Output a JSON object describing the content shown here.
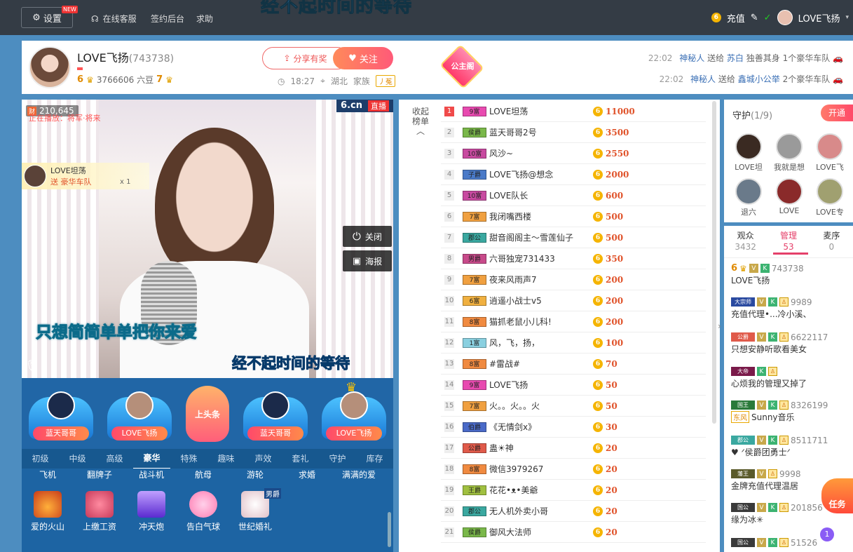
{
  "topbar": {
    "settings_label": "设置",
    "new_badge": "NEW",
    "nav": [
      "在线客服",
      "签约后台",
      "求助"
    ],
    "banner_text": "经不起时间的等待",
    "recharge_label": "充值",
    "user_name": "LOVE飞扬"
  },
  "anchor": {
    "name": "LOVE飞扬",
    "id": "(743738)",
    "level_rich": "6",
    "beans": "3766606 六豆",
    "level_star": "7",
    "share_label": "分享有奖",
    "follow_label": "关注",
    "time": "18:27",
    "location": "湖北",
    "family_label": "家族",
    "family_tag": "丿菟",
    "princess_label": "公主阁"
  },
  "broadcast": [
    {
      "time": "22:02",
      "from": "神秘人",
      "verb": "送给",
      "to": "苏白",
      "text": "独善其身 1个豪华车队"
    },
    {
      "time": "22:02",
      "from": "神秘人",
      "verb": "送给",
      "to": "鑫城小公举",
      "text": "2个豪华车队"
    }
  ],
  "video": {
    "fortune_icon": "财",
    "fortune_value": "210,645",
    "scroll_text": "正在播放：将军·将来",
    "logo": "6.cn",
    "live_tag": "直播",
    "gift_notice": {
      "name": "LOVE坦荡",
      "prefix": "送",
      "gift": "豪华车队",
      "count": "x 1"
    },
    "close_label": "关闭",
    "poster_label": "海报",
    "lyric_main": "只想简简单单把你来爱",
    "lyric_sub": "经不起时间的等待"
  },
  "seats": [
    {
      "name": "蓝天哥哥",
      "color": "#1b2a4a"
    },
    {
      "name": "LOVE飞扬",
      "color": "#b58f7a"
    },
    {
      "name": "上头条",
      "headline": true
    },
    {
      "name": "蓝天哥哥",
      "color": "#1b2a4a"
    },
    {
      "name": "LOVE飞扬",
      "color": "#b58f7a"
    }
  ],
  "gift_tabs": [
    "初级",
    "中级",
    "高级",
    "豪华",
    "特殊",
    "趣味",
    "声效",
    "套礼",
    "守护",
    "库存"
  ],
  "gift_tab_active": 3,
  "gifts_row1": [
    "飞机",
    "翻牌子",
    "战斗机",
    "航母",
    "游轮",
    "求婚",
    "满满的爱"
  ],
  "gifts_row2": [
    {
      "name": "爱的火山",
      "color": "#ff6a3a"
    },
    {
      "name": "上缴工资",
      "color": "#ff4a6a"
    },
    {
      "name": "冲天炮",
      "color": "#7a3aff"
    },
    {
      "name": "告白气球",
      "color": "#ff9acb"
    },
    {
      "name": "世纪婚礼",
      "color": "#ffe0e8",
      "tag": "男爵"
    }
  ],
  "rank": {
    "collapse_label": "收起榜单",
    "rows": [
      {
        "n": "1",
        "badge": "9富",
        "bc": "#e84ab0",
        "name": "LOVE坦荡",
        "val": "11000"
      },
      {
        "n": "2",
        "badge": "侯爵",
        "bc": "#7ab84a",
        "name": "蓝天哥哥2号",
        "val": "3500"
      },
      {
        "n": "3",
        "badge": "10富",
        "bc": "#c84aa0",
        "name": "风沙~",
        "val": "2550"
      },
      {
        "n": "4",
        "badge": "子爵",
        "bc": "#4a7ac8",
        "name": "LOVE飞扬@想念",
        "val": "2000"
      },
      {
        "n": "5",
        "badge": "10富",
        "bc": "#c84aa0",
        "name": "LOVE队长",
        "val": "600"
      },
      {
        "n": "6",
        "badge": "7富",
        "bc": "#f0a040",
        "name": "我闭嘴西楼",
        "val": "500"
      },
      {
        "n": "7",
        "badge": "郡公",
        "bc": "#3aa8a0",
        "name": "甜音阁阁主～雪莲仙子",
        "val": "500"
      },
      {
        "n": "8",
        "badge": "男爵",
        "bc": "#c84a8a",
        "name": "六哥独宠731433",
        "val": "350"
      },
      {
        "n": "9",
        "badge": "7富",
        "bc": "#f0a040",
        "name": "夜来风雨声7",
        "val": "200"
      },
      {
        "n": "10",
        "badge": "6富",
        "bc": "#f0b040",
        "name": "逍遥小战士v5",
        "val": "200"
      },
      {
        "n": "11",
        "badge": "8富",
        "bc": "#f08a40",
        "name": "猫抓老鼠小儿科!",
        "val": "200"
      },
      {
        "n": "12",
        "badge": "1富",
        "bc": "#8ad0e0",
        "name": "风，飞，扬，",
        "val": "100"
      },
      {
        "n": "13",
        "badge": "8富",
        "bc": "#f08a40",
        "name": "#雷战#",
        "val": "70"
      },
      {
        "n": "14",
        "badge": "9富",
        "bc": "#e84ab0",
        "name": "LOVE飞扬",
        "val": "50"
      },
      {
        "n": "15",
        "badge": "7富",
        "bc": "#f0a040",
        "name": "火。。火。。火",
        "val": "50"
      },
      {
        "n": "16",
        "badge": "伯爵",
        "bc": "#4a6ac8",
        "name": "《无情剑x》",
        "val": "30"
      },
      {
        "n": "17",
        "badge": "公爵",
        "bc": "#e05a4a",
        "name": "蛊☀神",
        "val": "20"
      },
      {
        "n": "18",
        "badge": "8富",
        "bc": "#f08a40",
        "name": "微信3979267",
        "val": "20"
      },
      {
        "n": "19",
        "badge": "王爵",
        "bc": "#a0c040",
        "name": "花花•ᴥ•美爺",
        "val": "20"
      },
      {
        "n": "20",
        "badge": "郡公",
        "bc": "#3aa8a0",
        "name": "无人机外卖小哥",
        "val": "20"
      },
      {
        "n": "21",
        "badge": "侯爵",
        "bc": "#7ab84a",
        "name": "御风大法师",
        "val": "20"
      }
    ]
  },
  "guard": {
    "title": "守护",
    "count": "(1/9)",
    "open_label": "开通",
    "members": [
      {
        "name": "LOVE坦",
        "color": "#3a2a22"
      },
      {
        "name": "我就是想",
        "color": "#9a9a9a"
      },
      {
        "name": "LOVE飞",
        "color": "#d88a8a"
      },
      {
        "name": "退六",
        "color": "#6a7a8a"
      },
      {
        "name": "LOVE",
        "color": "#8a2a2a"
      },
      {
        "name": "LOVE专",
        "color": "#a0a070"
      }
    ]
  },
  "users": {
    "tabs": [
      {
        "label": "观众",
        "count": "3432"
      },
      {
        "label": "管理",
        "count": "53"
      },
      {
        "label": "麦序",
        "count": "0"
      }
    ],
    "active_tab": 1,
    "rows": [
      {
        "lvl": "6",
        "badges": [
          "V",
          "K"
        ],
        "id": "743738",
        "name": "LOVE飞扬"
      },
      {
        "badge": "大宗师",
        "bcol": "#2a4aa0",
        "badges": [
          "V",
          "K",
          "P"
        ],
        "id": "9989",
        "name": "充值代理•...冷小溪、"
      },
      {
        "badge": "公爵",
        "bcol": "#e05a4a",
        "badges": [
          "V",
          "K",
          "P"
        ],
        "id": "6622117",
        "name": "只想安静听歌看美女"
      },
      {
        "badge": "大帝",
        "bcol": "#7a1a4a",
        "badges": [
          "K",
          "P"
        ],
        "id": "",
        "name": "心烦我的管理又掉了"
      },
      {
        "badge": "国王",
        "bcol": "#2a7a3a",
        "badges": [
          "V",
          "K",
          "P"
        ],
        "id": "8326199",
        "name": "Sunny音乐",
        "fam": "东风"
      },
      {
        "badge": "郡公",
        "bcol": "#3aa8a0",
        "badges": [
          "V",
          "K",
          "P"
        ],
        "id": "8511711",
        "name": "♥ ᐟ侯爵团勇士ᐟ"
      },
      {
        "badge": "藩王",
        "bcol": "#5a5a2a",
        "badges": [
          "V",
          "P"
        ],
        "id": "9998",
        "name": "金牌充值代理温居"
      },
      {
        "badge": "国公",
        "bcol": "#3a3a3a",
        "badges": [
          "V",
          "K",
          "P"
        ],
        "id": "201856",
        "name": "缘为冰✳"
      },
      {
        "badge": "国公",
        "bcol": "#3a3a3a",
        "badges": [
          "V",
          "K",
          "P"
        ],
        "id": "51526",
        "name": ""
      }
    ]
  },
  "floating": {
    "task_label": "任务",
    "unread": "1"
  }
}
